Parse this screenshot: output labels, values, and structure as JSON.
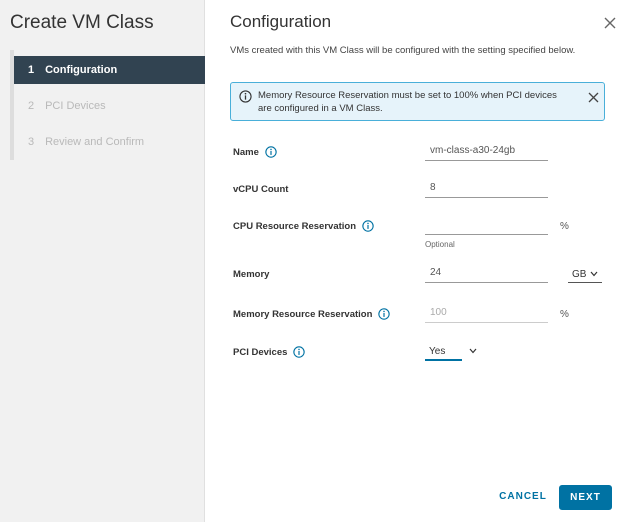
{
  "sidebar": {
    "title": "Create VM Class",
    "steps": [
      {
        "num": "1",
        "label": "Configuration"
      },
      {
        "num": "2",
        "label": "PCI Devices"
      },
      {
        "num": "3",
        "label": "Review and Confirm"
      }
    ]
  },
  "main": {
    "title": "Configuration",
    "description": "VMs created with this VM Class will be configured with the setting specified below.",
    "alert": "Memory Resource Reservation must be set to 100% when PCI devices are configured in a VM Class."
  },
  "form": {
    "name": {
      "label": "Name",
      "value": "vm-class-a30-24gb"
    },
    "vcpu": {
      "label": "vCPU Count",
      "value": "8"
    },
    "cpu_reservation": {
      "label": "CPU Resource Reservation",
      "value": "",
      "unit": "%",
      "helper": "Optional"
    },
    "memory": {
      "label": "Memory",
      "value": "24",
      "unit": "GB"
    },
    "memory_reservation": {
      "label": "Memory Resource Reservation",
      "value": "100",
      "unit": "%"
    },
    "pci_devices": {
      "label": "PCI Devices",
      "value": "Yes"
    }
  },
  "buttons": {
    "cancel": "CANCEL",
    "next": "NEXT"
  },
  "colors": {
    "accent": "#0072a3",
    "active_step": "#314351",
    "alert_bg": "#e6f3fa",
    "alert_border": "#49afd9"
  }
}
